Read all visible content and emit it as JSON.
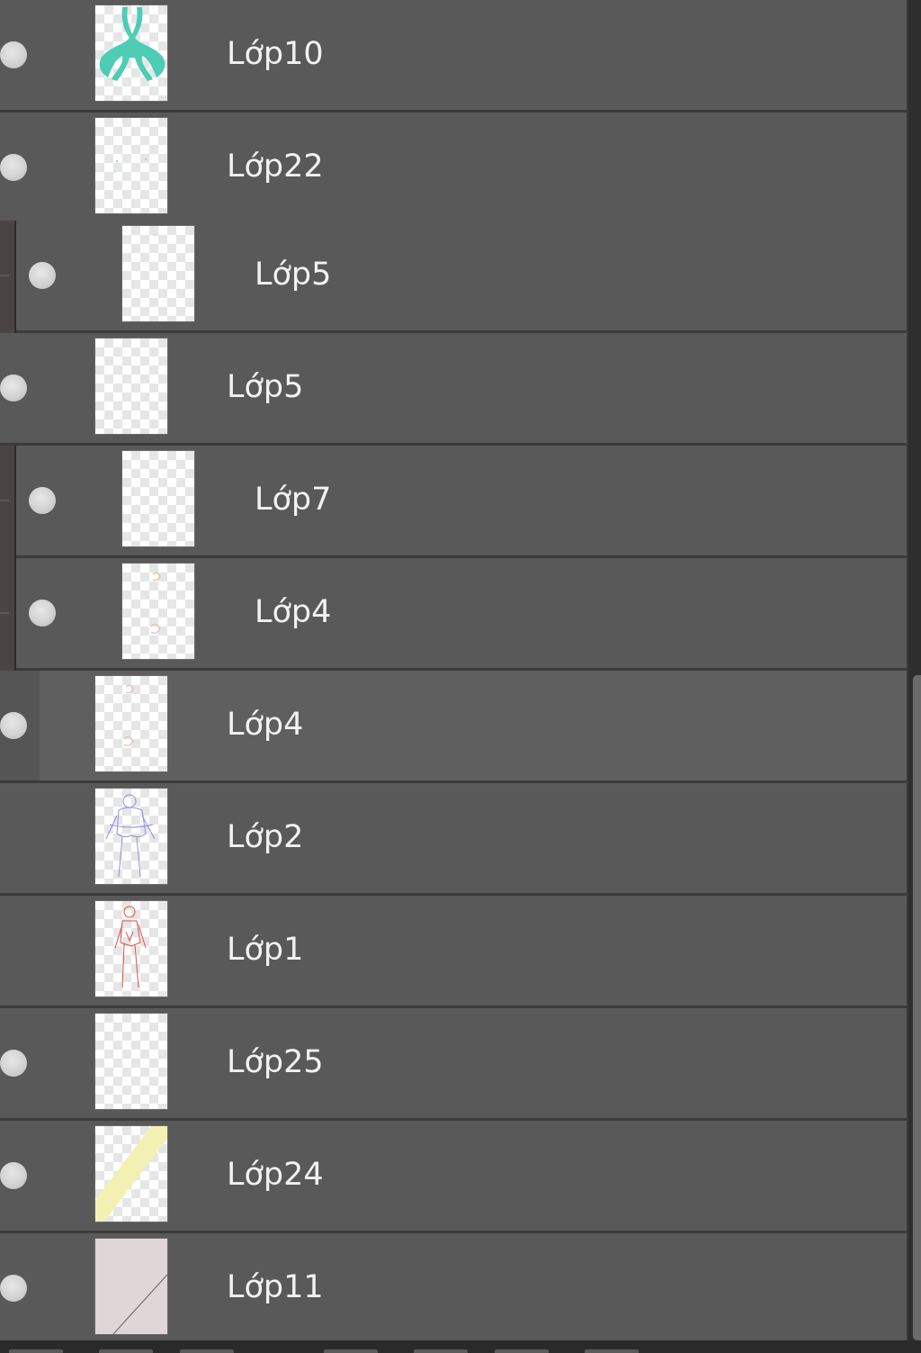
{
  "panel": {
    "name": "layers-panel"
  },
  "layers": [
    {
      "label": "Lớp10",
      "visible": true,
      "indent": 0,
      "thumb": "teal-figure"
    },
    {
      "label": "Lớp22",
      "visible": true,
      "indent": 0,
      "thumb": "faint-dots"
    },
    {
      "label": "Lớp5",
      "visible": true,
      "indent": 1,
      "thumb": "empty"
    },
    {
      "label": "Lớp5",
      "visible": true,
      "indent": 0,
      "thumb": "empty"
    },
    {
      "label": "Lớp7",
      "visible": true,
      "indent": 1,
      "thumb": "empty"
    },
    {
      "label": "Lớp4",
      "visible": true,
      "indent": 1,
      "thumb": "pink-marks"
    },
    {
      "label": "Lớp4",
      "visible": true,
      "indent": 0,
      "thumb": "pink-marks",
      "selected": true
    },
    {
      "label": "Lớp2",
      "visible": false,
      "indent": 0,
      "thumb": "blue-sketch"
    },
    {
      "label": "Lớp1",
      "visible": false,
      "indent": 0,
      "thumb": "red-sketch"
    },
    {
      "label": "Lớp25",
      "visible": true,
      "indent": 0,
      "thumb": "empty"
    },
    {
      "label": "Lớp24",
      "visible": true,
      "indent": 0,
      "thumb": "yellow-stripe"
    },
    {
      "label": "Lớp11",
      "visible": true,
      "indent": 0,
      "thumb": "mauve-fill"
    }
  ],
  "colors": {
    "row_bg": "#595959",
    "divider": "#3b3b3b",
    "label_text": "#f2f2f2",
    "eye": "#d2d2d2",
    "teal": "#4ccdb4",
    "yellow": "#f3f0b4",
    "mauve": "#e0d6d8"
  }
}
